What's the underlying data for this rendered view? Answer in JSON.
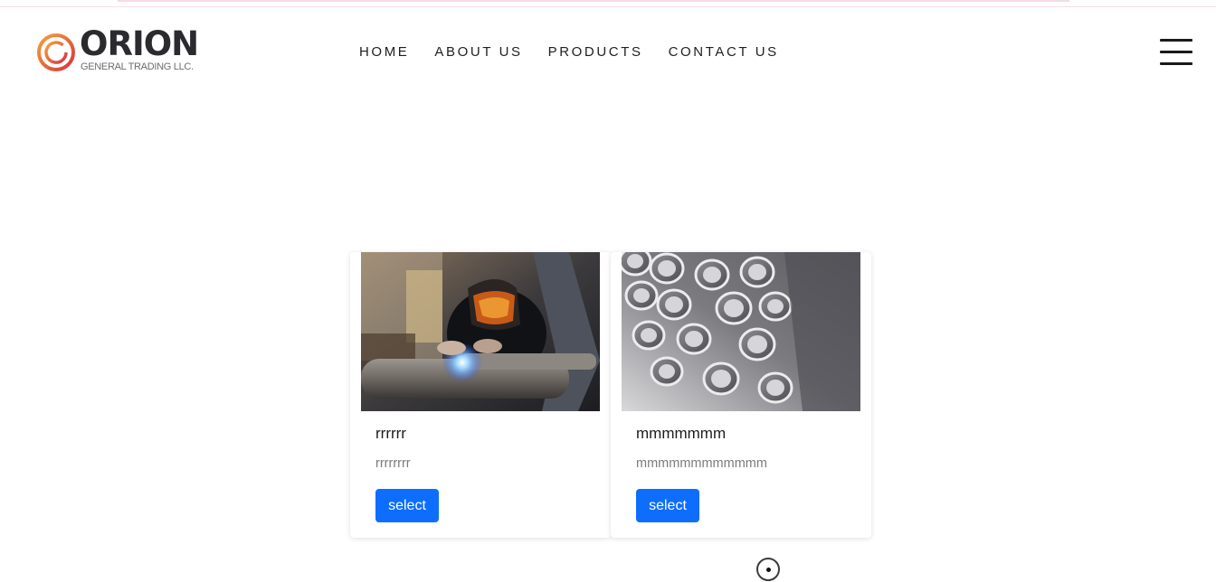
{
  "brand": {
    "name": "ORION",
    "tagline": "GENERAL TRADING LLC."
  },
  "nav": {
    "items": [
      {
        "label": "HOME"
      },
      {
        "label": "ABOUT US"
      },
      {
        "label": "PRODUCTS"
      },
      {
        "label": "CONTACT US"
      }
    ]
  },
  "menu": {
    "icon": "hamburger-menu-icon"
  },
  "products": [
    {
      "image": "welder-photo",
      "title": "rrrrrr",
      "description": "rrrrrrrr",
      "button_label": "select"
    },
    {
      "image": "steel-pipes-photo",
      "title": "mmmmmmm",
      "description": "mmmmmmmmmmmm",
      "button_label": "select"
    }
  ],
  "colors": {
    "button": "#0d6efd",
    "logo_orange": "#f08a3c",
    "logo_red": "#e2453c",
    "logo_dark": "#2b2a2e"
  }
}
